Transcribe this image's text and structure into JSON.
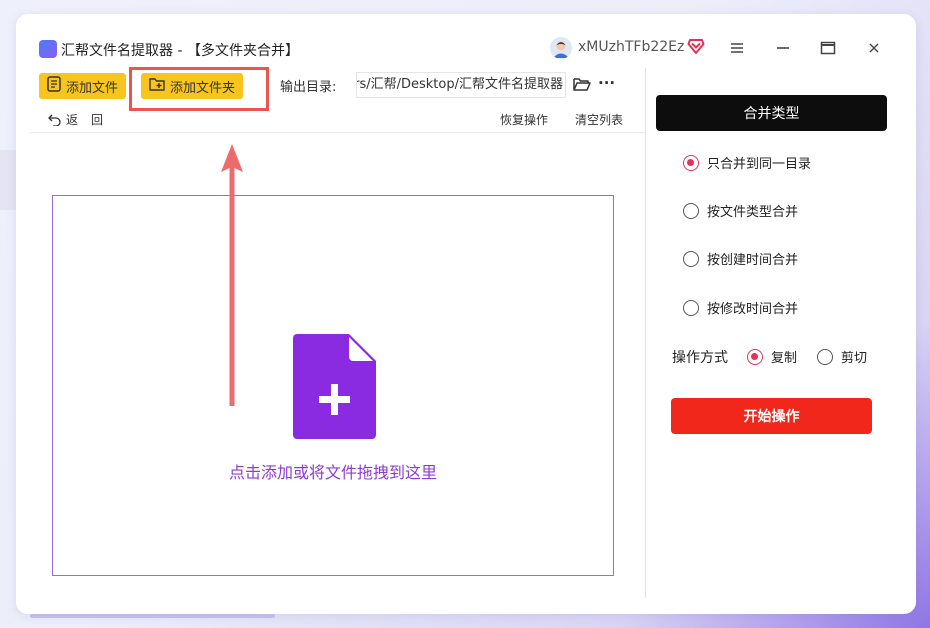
{
  "window": {
    "title": "汇帮文件名提取器 - 【多文件夹合并】",
    "username": "xMUzhTFb22Ez"
  },
  "toolbar": {
    "add_file_label": "添加文件",
    "add_folder_label": "添加文件夹",
    "output_dir_label": "输出目录:",
    "output_dir_value": "C:/Users/汇帮/Desktop/汇帮文件名提取器",
    "more_label": "···",
    "back_label": "返",
    "back_label2": "回",
    "restore_label": "恢复操作",
    "clear_label": "清空列表"
  },
  "dropzone": {
    "hint": "点击添加或将文件拖拽到这里"
  },
  "merge_panel": {
    "title": "合并类型",
    "options": [
      {
        "label": "只合并到同一目录",
        "selected": true
      },
      {
        "label": "按文件类型合并",
        "selected": false
      },
      {
        "label": "按创建时间合并",
        "selected": false
      },
      {
        "label": "按修改时间合并",
        "selected": false
      }
    ],
    "operation_label": "操作方式",
    "operation_options": [
      {
        "label": "复制",
        "selected": true
      },
      {
        "label": "剪切",
        "selected": false
      }
    ],
    "start_label": "开始操作"
  },
  "colors": {
    "accent_yellow": "#f7c51e",
    "highlight_red": "#e8574f",
    "radio_active": "#e5315a",
    "start_button": "#f0271a",
    "dropzone_purple": "#8d3bd6",
    "file_icon_purple": "#8a2be2"
  }
}
